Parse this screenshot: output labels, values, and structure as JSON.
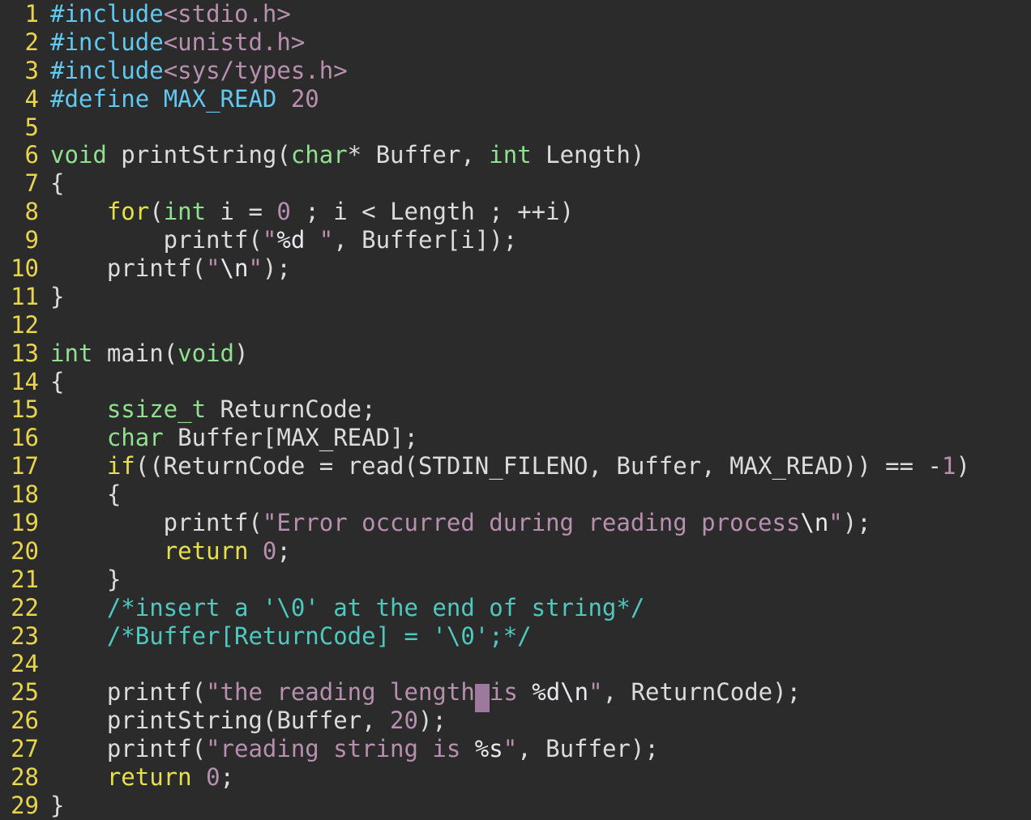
{
  "editor": {
    "language": "C",
    "total_lines": 29,
    "background_color": "#2b2b2b",
    "line_number_color": "#e8d44d",
    "cursor": {
      "line": 25,
      "color": "#9d7a9d",
      "style": "block",
      "after_text": "printf(\"the reading length"
    },
    "palette": {
      "preprocessor": "#62c8f0",
      "header_path": "#b98fb0",
      "number": "#b98fb0",
      "type_keyword": "#8fe08f",
      "control_keyword": "#e8e04a",
      "identifier": "#dcdcdc",
      "string": "#b98fb0",
      "format_specifier": "#e9e9ef",
      "escape": "#e9e9ef",
      "comment": "#4ec9c0"
    }
  },
  "gutter": {
    "numbers": [
      "1",
      "2",
      "3",
      "4",
      "5",
      "6",
      "7",
      "8",
      "9",
      "10",
      "11",
      "12",
      "13",
      "14",
      "15",
      "16",
      "17",
      "18",
      "19",
      "20",
      "21",
      "22",
      "23",
      "24",
      "25",
      "26",
      "27",
      "28",
      "29"
    ]
  },
  "lines": [
    {
      "n": "1",
      "text": "#include<stdio.h>"
    },
    {
      "n": "2",
      "text": "#include<unistd.h>"
    },
    {
      "n": "3",
      "text": "#include<sys/types.h>"
    },
    {
      "n": "4",
      "text": "#define MAX_READ 20"
    },
    {
      "n": "5",
      "text": ""
    },
    {
      "n": "6",
      "text": "void printString(char* Buffer, int Length)"
    },
    {
      "n": "7",
      "text": "{"
    },
    {
      "n": "8",
      "text": "    for(int i = 0 ; i < Length ; ++i)"
    },
    {
      "n": "9",
      "text": "        printf(\"%d \", Buffer[i]);"
    },
    {
      "n": "10",
      "text": "    printf(\"\\n\");"
    },
    {
      "n": "11",
      "text": "}"
    },
    {
      "n": "12",
      "text": ""
    },
    {
      "n": "13",
      "text": "int main(void)"
    },
    {
      "n": "14",
      "text": "{"
    },
    {
      "n": "15",
      "text": "    ssize_t ReturnCode;"
    },
    {
      "n": "16",
      "text": "    char Buffer[MAX_READ];"
    },
    {
      "n": "17",
      "text": "    if((ReturnCode = read(STDIN_FILENO, Buffer, MAX_READ)) == -1)"
    },
    {
      "n": "18",
      "text": "    {"
    },
    {
      "n": "19",
      "text": "        printf(\"Error occurred during reading process\\n\");"
    },
    {
      "n": "20",
      "text": "        return 0;"
    },
    {
      "n": "21",
      "text": "    }"
    },
    {
      "n": "22",
      "text": "    /*insert a '\\0' at the end of string*/"
    },
    {
      "n": "23",
      "text": "    /*Buffer[ReturnCode] = '\\0';*/"
    },
    {
      "n": "24",
      "text": ""
    },
    {
      "n": "25",
      "text": "    printf(\"the reading length is %d\\n\", ReturnCode);"
    },
    {
      "n": "26",
      "text": "    printString(Buffer, 20);"
    },
    {
      "n": "27",
      "text": "    printf(\"reading string is %s\", Buffer);"
    },
    {
      "n": "28",
      "text": "    return 0;"
    },
    {
      "n": "29",
      "text": "}"
    }
  ],
  "tokens": {
    "l1": [
      [
        "pp",
        "#include"
      ],
      [
        "hdr",
        "<stdio.h>"
      ]
    ],
    "l2": [
      [
        "pp",
        "#include"
      ],
      [
        "hdr",
        "<unistd.h>"
      ]
    ],
    "l3": [
      [
        "pp",
        "#include"
      ],
      [
        "hdr",
        "<sys/types.h>"
      ]
    ],
    "l4": [
      [
        "pp",
        "#define "
      ],
      [
        "pp",
        "MAX_READ"
      ],
      [
        "id",
        " "
      ],
      [
        "num",
        "20"
      ]
    ],
    "l5": [],
    "l6": [
      [
        "type",
        "void"
      ],
      [
        "id",
        " printString("
      ],
      [
        "type",
        "char"
      ],
      [
        "id",
        "* Buffer, "
      ],
      [
        "type",
        "int"
      ],
      [
        "id",
        " Length)"
      ]
    ],
    "l7": [
      [
        "id",
        "{"
      ]
    ],
    "l8": [
      [
        "id",
        "    "
      ],
      [
        "kw",
        "for"
      ],
      [
        "id",
        "("
      ],
      [
        "type",
        "int"
      ],
      [
        "id",
        " i = "
      ],
      [
        "num",
        "0"
      ],
      [
        "id",
        " ; i < Length ; ++i)"
      ]
    ],
    "l9": [
      [
        "id",
        "        printf("
      ],
      [
        "str",
        "\""
      ],
      [
        "fmt",
        "%d"
      ],
      [
        "str",
        " \""
      ],
      [
        "id",
        ", Buffer[i]);"
      ]
    ],
    "l10": [
      [
        "id",
        "    printf("
      ],
      [
        "str",
        "\""
      ],
      [
        "esc",
        "\\n"
      ],
      [
        "str",
        "\""
      ],
      [
        "id",
        ");"
      ]
    ],
    "l11": [
      [
        "id",
        "}"
      ]
    ],
    "l12": [],
    "l13": [
      [
        "type",
        "int"
      ],
      [
        "id",
        " main("
      ],
      [
        "type",
        "void"
      ],
      [
        "id",
        ")"
      ]
    ],
    "l14": [
      [
        "id",
        "{"
      ]
    ],
    "l15": [
      [
        "id",
        "    "
      ],
      [
        "type",
        "ssize_t"
      ],
      [
        "id",
        " ReturnCode;"
      ]
    ],
    "l16": [
      [
        "id",
        "    "
      ],
      [
        "type",
        "char"
      ],
      [
        "id",
        " Buffer[MAX_READ];"
      ]
    ],
    "l17": [
      [
        "id",
        "    "
      ],
      [
        "kw",
        "if"
      ],
      [
        "id",
        "((ReturnCode = read(STDIN_FILENO, Buffer, MAX_READ)) == -"
      ],
      [
        "num",
        "1"
      ],
      [
        "id",
        ")"
      ]
    ],
    "l18": [
      [
        "id",
        "    {"
      ]
    ],
    "l19": [
      [
        "id",
        "        printf("
      ],
      [
        "str",
        "\"Error occurred during reading process"
      ],
      [
        "esc",
        "\\n"
      ],
      [
        "str",
        "\""
      ],
      [
        "id",
        ");"
      ]
    ],
    "l20": [
      [
        "id",
        "        "
      ],
      [
        "kw",
        "return"
      ],
      [
        "id",
        " "
      ],
      [
        "num",
        "0"
      ],
      [
        "id",
        ";"
      ]
    ],
    "l21": [
      [
        "id",
        "    }"
      ]
    ],
    "l22": [
      [
        "id",
        "    "
      ],
      [
        "cmt",
        "/*insert a '\\0' at the end of string*/"
      ]
    ],
    "l23": [
      [
        "id",
        "    "
      ],
      [
        "cmt",
        "/*Buffer[ReturnCode] = '\\0';*/"
      ]
    ],
    "l24": [],
    "l25": [
      [
        "id",
        "    printf("
      ],
      [
        "str",
        "\"the reading length"
      ],
      [
        "CURSOR",
        ""
      ],
      [
        "str",
        "is "
      ],
      [
        "fmt",
        "%d"
      ],
      [
        "esc",
        "\\n"
      ],
      [
        "str",
        "\""
      ],
      [
        "id",
        ", ReturnCode);"
      ]
    ],
    "l26": [
      [
        "id",
        "    printString(Buffer, "
      ],
      [
        "num",
        "20"
      ],
      [
        "id",
        ");"
      ]
    ],
    "l27": [
      [
        "id",
        "    printf("
      ],
      [
        "str",
        "\"reading string is "
      ],
      [
        "fmt",
        "%s"
      ],
      [
        "str",
        "\""
      ],
      [
        "id",
        ", Buffer);"
      ]
    ],
    "l28": [
      [
        "id",
        "    "
      ],
      [
        "kw",
        "return"
      ],
      [
        "id",
        " "
      ],
      [
        "num",
        "0"
      ],
      [
        "id",
        ";"
      ]
    ],
    "l29": [
      [
        "id",
        "}"
      ]
    ]
  }
}
